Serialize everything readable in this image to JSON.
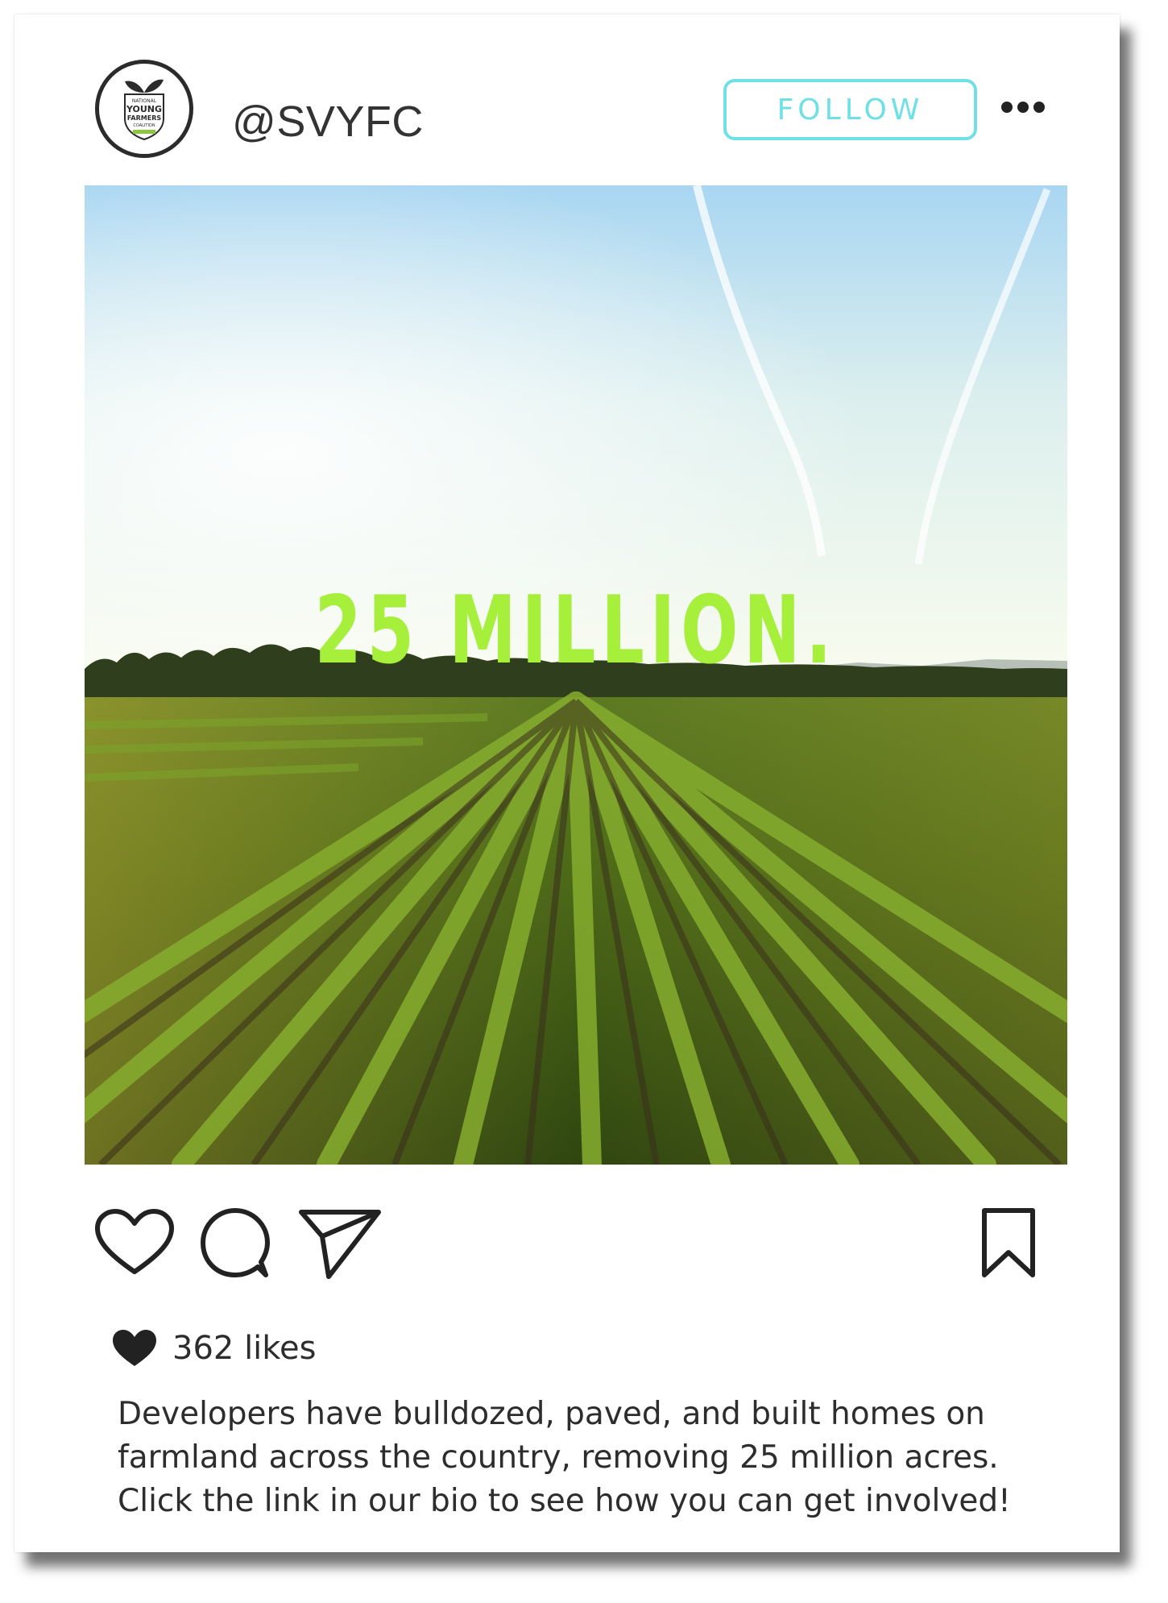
{
  "post": {
    "handle": "@SVYFC",
    "follow_label": "FOLLOW",
    "avatar_logo": {
      "line1": "NATIONAL",
      "line2": "YOUNG",
      "line3": "FARMERS",
      "line4": "COALITION"
    },
    "headline": "25 MILLION.",
    "likes": "362 likes",
    "caption_lines": [
      "Developers have bulldozed, paved, and built homes on",
      "farmland across the country, removing 25 million acres.",
      "Click the link in our bio to see how you can get involved!"
    ]
  },
  "icons": {
    "avatar": "young-farmers-logo",
    "more": "more-dots-icon",
    "like": "heart-icon",
    "comment": "comment-bubble-icon",
    "share": "paper-plane-icon",
    "save": "bookmark-icon",
    "likes_heart": "filled-heart-icon"
  },
  "colors": {
    "follow_accent": "#6fe0e6",
    "headline": "#a6ef3a",
    "text": "#2d2d2d"
  }
}
